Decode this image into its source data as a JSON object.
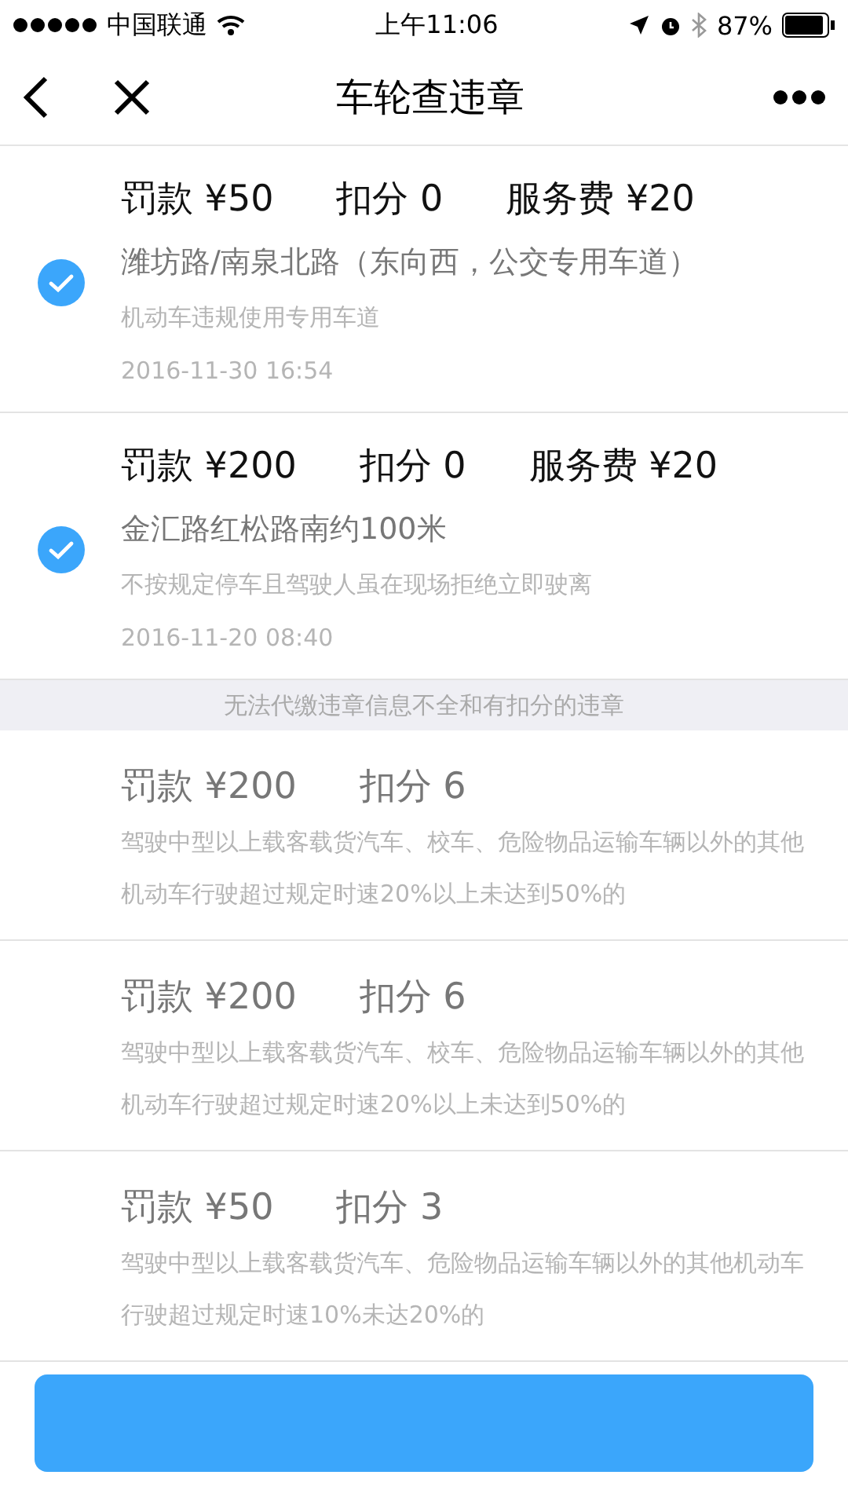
{
  "status_bar": {
    "carrier": "中国联通",
    "time": "上午11:06",
    "battery": "87%"
  },
  "nav": {
    "title": "车轮查违章"
  },
  "payable": [
    {
      "fine": "罚款 ¥50",
      "points": "扣分 0",
      "fee": "服务费 ¥20",
      "location": "潍坊路/南泉北路（东向西，公交专用车道）",
      "reason": "机动车违规使用专用车道",
      "date": "2016-11-30 16:54",
      "checked": true
    },
    {
      "fine": "罚款 ¥200",
      "points": "扣分 0",
      "fee": "服务费 ¥20",
      "location": "金汇路红松路南约100米",
      "reason": "不按规定停车且驾驶人虽在现场拒绝立即驶离",
      "date": "2016-11-20 08:40",
      "checked": true
    }
  ],
  "unpayable_header": "无法代缴违章信息不全和有扣分的违章",
  "unpayable": [
    {
      "fine": "罚款 ¥200",
      "points": "扣分 6",
      "reason": "驾驶中型以上载客载货汽车、校车、危险物品运输车辆以外的其他机动车行驶超过规定时速20%以上未达到50%的"
    },
    {
      "fine": "罚款 ¥200",
      "points": "扣分 6",
      "reason": "驾驶中型以上载客载货汽车、校车、危险物品运输车辆以外的其他机动车行驶超过规定时速20%以上未达到50%的"
    },
    {
      "fine": "罚款 ¥50",
      "points": "扣分 3",
      "reason": "驾驶中型以上载客载货汽车、危险物品运输车辆以外的其他机动车行驶超过规定时速10%未达20%的"
    }
  ]
}
